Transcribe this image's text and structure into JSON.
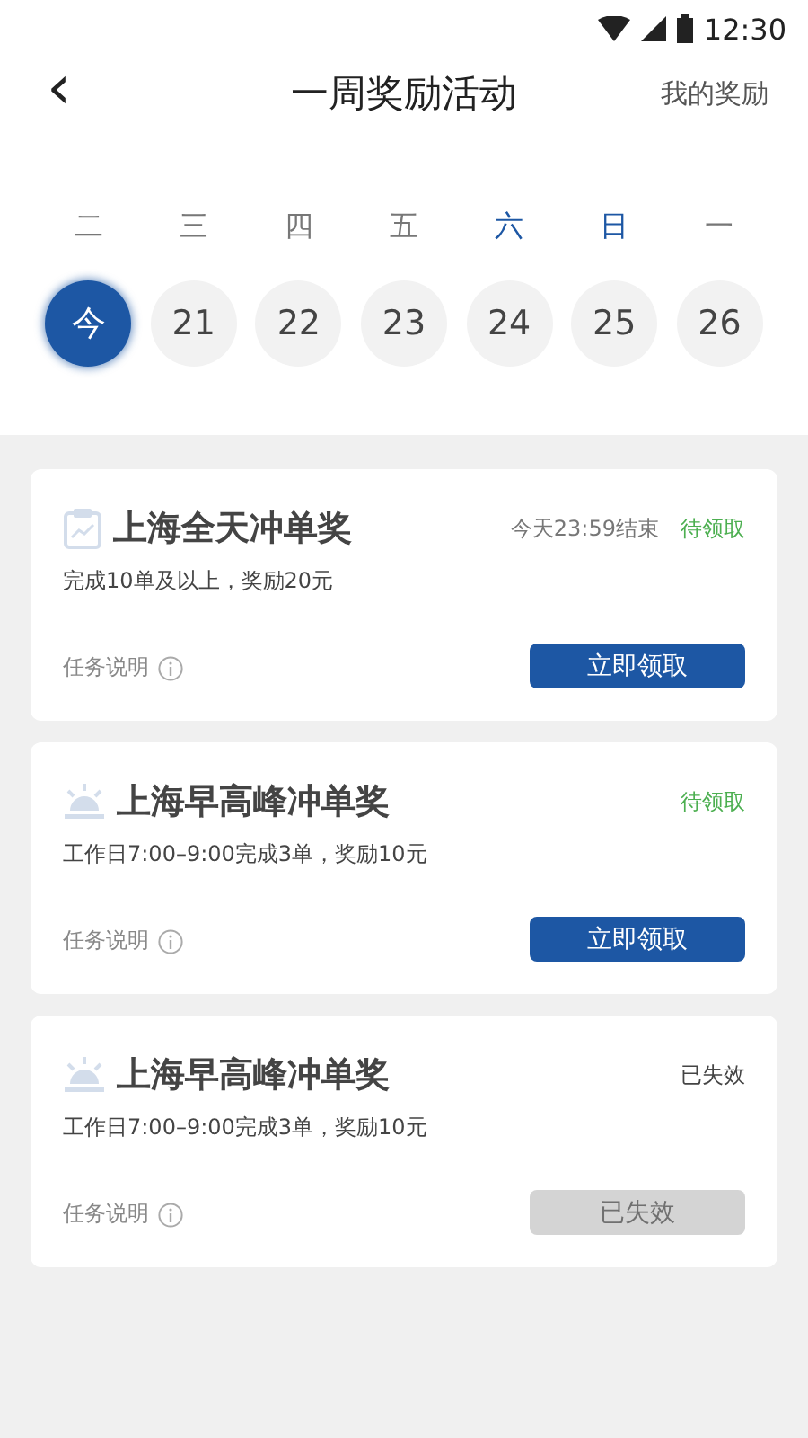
{
  "status_bar": {
    "time": "12:30"
  },
  "header": {
    "back": "‹",
    "title": "一周奖励活动",
    "action": "我的奖励"
  },
  "days": [
    {
      "weekday": "二",
      "weekend": false,
      "date": "今",
      "selected": true
    },
    {
      "weekday": "三",
      "weekend": false,
      "date": "21",
      "selected": false
    },
    {
      "weekday": "四",
      "weekend": false,
      "date": "22",
      "selected": false
    },
    {
      "weekday": "五",
      "weekend": false,
      "date": "23",
      "selected": false
    },
    {
      "weekday": "六",
      "weekend": true,
      "date": "24",
      "selected": false
    },
    {
      "weekday": "日",
      "weekend": true,
      "date": "25",
      "selected": false
    },
    {
      "weekday": "一",
      "weekend": false,
      "date": "26",
      "selected": false
    }
  ],
  "tasks": [
    {
      "kind": "all_day",
      "title": "上海全天冲单奖",
      "deadline": "今天23:59结束",
      "status": "待领取",
      "expired": false,
      "description": "完成10单及以上，奖励20元",
      "info": "任务说明",
      "button": "立即领取"
    },
    {
      "kind": "peak",
      "title": "上海早高峰冲单奖",
      "status": "待领取",
      "expired": false,
      "description": "工作日7:00–9:00完成3单，奖励10元",
      "info": "任务说明",
      "button": "立即领取"
    },
    {
      "kind": "peak",
      "title": "上海早高峰冲单奖",
      "status": "已失效",
      "expired": true,
      "description": "工作日7:00–9:00完成3单，奖励10元",
      "info": "任务说明",
      "button": "已失效"
    }
  ]
}
